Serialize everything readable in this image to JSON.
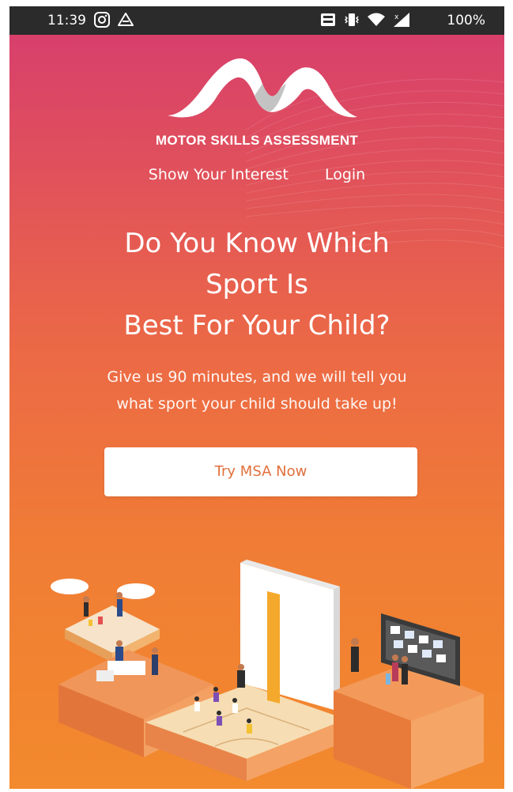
{
  "status_bar": {
    "time": "11:39",
    "battery": "100%",
    "icons": [
      "instagram-icon",
      "drive-icon",
      "volte-icon",
      "vibrate-icon",
      "wifi-icon",
      "signal-icon"
    ]
  },
  "brand": {
    "name": "MOTOR SKILLS ASSESSMENT"
  },
  "nav": {
    "show_interest": "Show Your Interest",
    "login": "Login"
  },
  "hero": {
    "headline_lines": [
      "Do You Know Which",
      "Sport Is",
      "Best For Your Child?"
    ],
    "subline_lines": [
      "Give us 90 minutes, and we will tell you",
      "what sport your child should take up!"
    ],
    "cta_label": "Try MSA Now"
  },
  "colors": {
    "gradient_top": "#d63c6f",
    "gradient_bottom": "#f38a2d",
    "cta_text": "#e0703c",
    "status_bar": "#2b2b2b"
  }
}
